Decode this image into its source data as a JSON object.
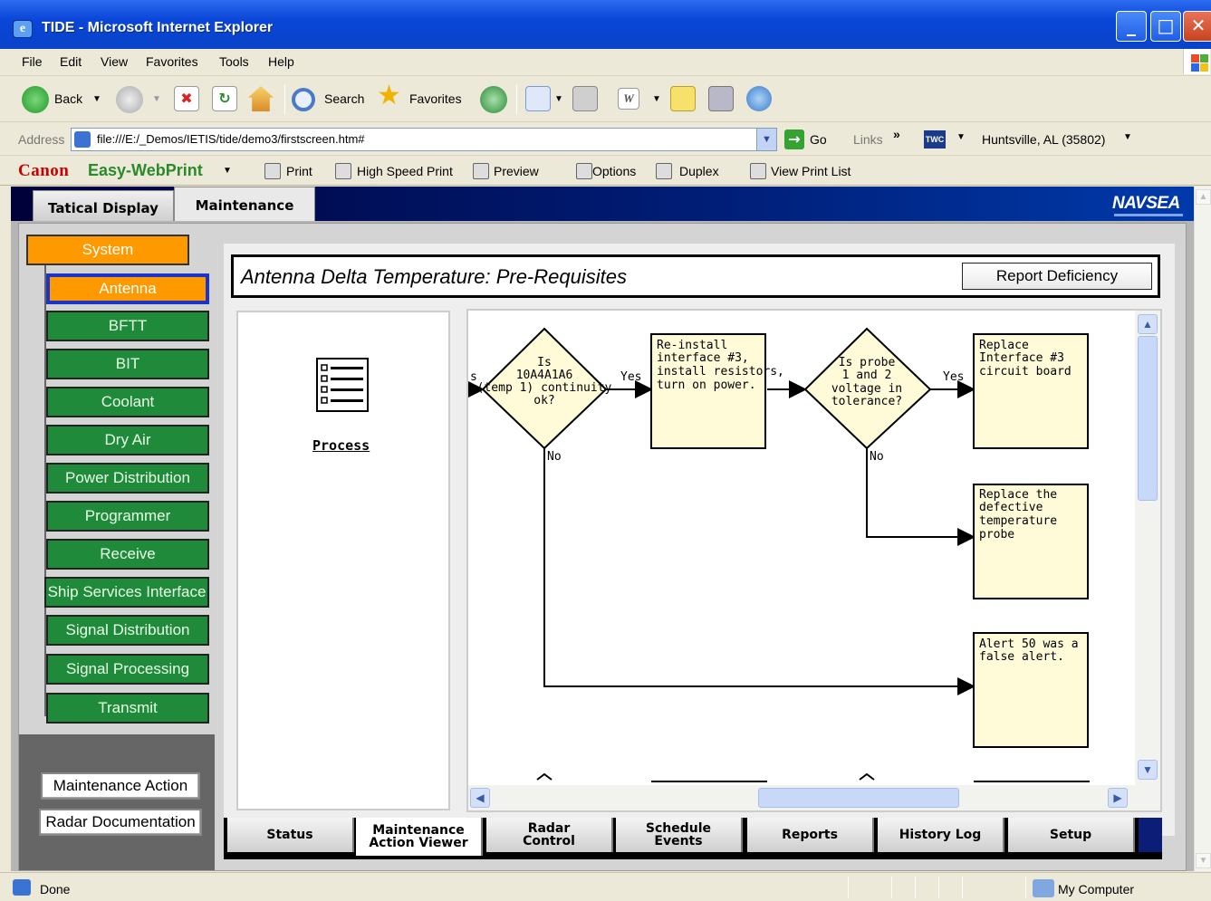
{
  "window": {
    "title": "TIDE - Microsoft Internet Explorer"
  },
  "menu": [
    "File",
    "Edit",
    "View",
    "Favorites",
    "Tools",
    "Help"
  ],
  "toolbar": {
    "back": "Back",
    "search": "Search",
    "favorites": "Favorites"
  },
  "address": {
    "label": "Address",
    "url": "file:///E:/_Demos/IETIS/tide/demo3/firstscreen.htm#",
    "go": "Go",
    "links": "Links",
    "links_more": "»",
    "twc": "TWC",
    "location": "Huntsville, AL (35802)"
  },
  "canon": {
    "brand": "Canon",
    "product": "Easy-WebPrint",
    "print": "Print",
    "high_speed_print": "High Speed Print",
    "preview": "Preview",
    "options": "Options",
    "duplex": "Duplex",
    "view_print_list": "View Print List"
  },
  "app": {
    "tabs": {
      "tactical": "Tatical Display",
      "maintenance": "Maintenance"
    },
    "logo": "NAVSEA",
    "tree": {
      "root": "System",
      "items": [
        "Antenna",
        "BFTT",
        "BIT",
        "Coolant",
        "Dry Air",
        "Power Distribution",
        "Programmer",
        "Receive",
        "Ship Services Interface",
        "Signal Distribution",
        "Signal Processing",
        "Transmit"
      ],
      "selected": "Antenna"
    },
    "left_buttons": {
      "maintenance_action": "Maintenance Action",
      "radar_documentation": "Radar Documentation"
    },
    "page_title": "Antenna Delta Temperature: Pre-Requisites",
    "report_button": "Report Deficiency",
    "process_label": "Process",
    "bottom_tabs": [
      {
        "label": "Status",
        "active": false
      },
      {
        "label": "Maintenance\nAction Viewer",
        "active": true
      },
      {
        "label": "Radar\nControl",
        "active": false
      },
      {
        "label": "Schedule\nEvents",
        "active": false
      },
      {
        "label": "Reports",
        "active": false
      },
      {
        "label": "History Log",
        "active": false
      },
      {
        "label": "Setup",
        "active": false
      }
    ]
  },
  "flow": {
    "decision1": [
      "Is",
      "10A4A1A6",
      "(temp 1) continuity",
      "ok?"
    ],
    "decision1_edge_in": "s",
    "reinstall": [
      "Re-install",
      "interface #3,",
      "install resistors,",
      "turn on power."
    ],
    "decision2": [
      "Is probe",
      "1 and 2",
      "voltage in",
      "tolerance?"
    ],
    "replace_board": [
      "Replace",
      "Interface #3",
      "circuit board"
    ],
    "replace_probe": [
      "Replace the",
      "defective",
      "temperature",
      "probe"
    ],
    "false_alert": [
      "Alert 50 was a",
      "false alert."
    ],
    "yes": "Yes",
    "no": "No"
  },
  "status": {
    "text": "Done",
    "zone": "My Computer"
  }
}
